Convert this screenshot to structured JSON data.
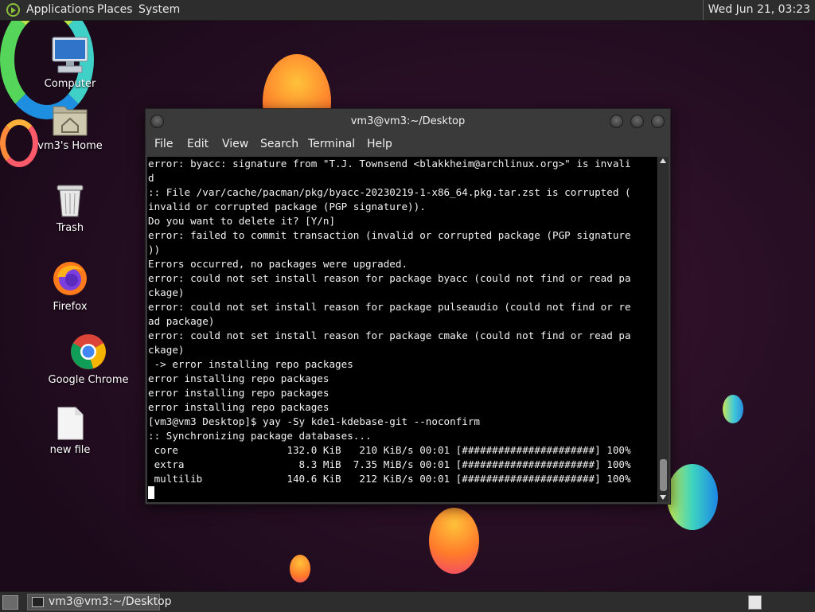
{
  "top_panel": {
    "menus": [
      "Applications",
      "Places",
      "System"
    ],
    "clock": "Wed Jun 21, 03:23"
  },
  "desktop_icons": [
    {
      "label": "Computer",
      "icon": "computer-icon"
    },
    {
      "label": "vm3's Home",
      "icon": "home-folder-icon"
    },
    {
      "label": "Trash",
      "icon": "trash-icon"
    },
    {
      "label": "Firefox",
      "icon": "firefox-icon"
    },
    {
      "label": "Google Chrome",
      "icon": "chrome-icon"
    },
    {
      "label": "new file",
      "icon": "file-icon"
    }
  ],
  "terminal": {
    "title": "vm3@vm3:~/Desktop",
    "menu": [
      "File",
      "Edit",
      "View",
      "Search",
      "Terminal",
      "Help"
    ],
    "lines": [
      "error: byacc: signature from \"T.J. Townsend <blakkheim@archlinux.org>\" is invali",
      "d",
      ":: File /var/cache/pacman/pkg/byacc-20230219-1-x86_64.pkg.tar.zst is corrupted (",
      "invalid or corrupted package (PGP signature)).",
      "Do you want to delete it? [Y/n]",
      "error: failed to commit transaction (invalid or corrupted package (PGP signature",
      "))",
      "Errors occurred, no packages were upgraded.",
      "error: could not set install reason for package byacc (could not find or read pa",
      "ckage)",
      "error: could not set install reason for package pulseaudio (could not find or re",
      "ad package)",
      "error: could not set install reason for package cmake (could not find or read pa",
      "ckage)",
      " -> error installing repo packages",
      "error installing repo packages",
      "error installing repo packages",
      "error installing repo packages",
      "[vm3@vm3 Desktop]$ yay -Sy kde1-kdebase-git --noconfirm",
      ":: Synchronizing package databases...",
      " core                  132.0 KiB   210 KiB/s 00:01 [######################] 100%",
      " extra                   8.3 MiB  7.35 MiB/s 00:01 [######################] 100%",
      " multilib              140.6 KiB   212 KiB/s 00:01 [######################] 100%"
    ]
  },
  "taskbar": {
    "task_label": "vm3@vm3:~/Desktop"
  },
  "colors": {
    "terminal_bg": "#000000",
    "panel_bg": "#2d2d2d",
    "accent_logo": "#8bbf3a"
  }
}
